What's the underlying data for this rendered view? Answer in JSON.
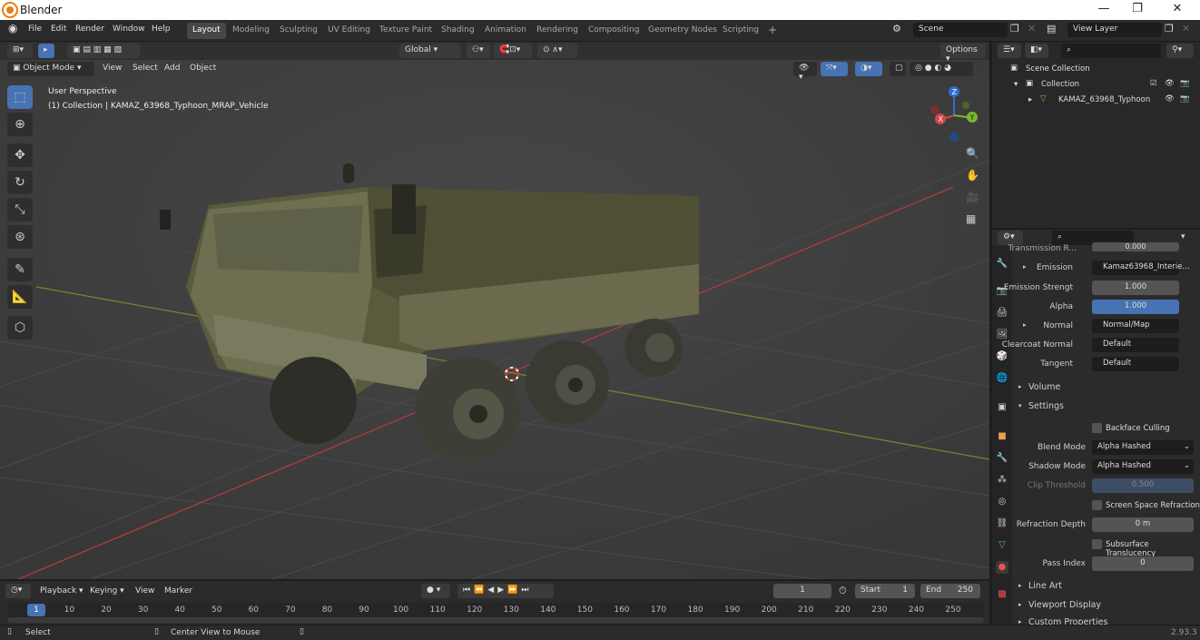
{
  "window": {
    "title": "Blender",
    "minimize": "—",
    "maximize": "❐",
    "close": "✕"
  },
  "menus": [
    "File",
    "Edit",
    "Render",
    "Window",
    "Help"
  ],
  "workspaces": [
    "Layout",
    "Modeling",
    "Sculpting",
    "UV Editing",
    "Texture Paint",
    "Shading",
    "Animation",
    "Rendering",
    "Compositing",
    "Geometry Nodes",
    "Scripting"
  ],
  "active_workspace": "Layout",
  "scene": {
    "name": "Scene",
    "view_layer": "View Layer"
  },
  "viewport_header": {
    "orientation": "Global",
    "options": "Options",
    "mode": "Object Mode",
    "menus": [
      "View",
      "Select",
      "Add",
      "Object"
    ]
  },
  "viewport": {
    "perspective": "User Perspective",
    "collection_info": "(1) Collection | KAMAZ_63968_Typhoon_MRAP_Vehicle"
  },
  "gizmo": {
    "x": "X",
    "y": "Y",
    "z": "Z"
  },
  "outliner": {
    "root": "Scene Collection",
    "collection": "Collection",
    "object": "KAMAZ_63968_Typhoon"
  },
  "properties": {
    "cut_label": "Transmission R...",
    "cut_value": "0.000",
    "rows": [
      {
        "label": "Emission",
        "value": "Kamaz63968_Interie...",
        "kind": "dark",
        "expand": true
      },
      {
        "label": "Emission Strengt",
        "value": "1.000",
        "kind": "normal"
      },
      {
        "label": "Alpha",
        "value": "1.000",
        "kind": "blue"
      },
      {
        "label": "Normal",
        "value": "Normal/Map",
        "kind": "dark",
        "expand": true
      },
      {
        "label": "Clearcoat Normal",
        "value": "Default",
        "kind": "dark"
      },
      {
        "label": "Tangent",
        "value": "Default",
        "kind": "dark"
      }
    ],
    "volume": "Volume",
    "settings": "Settings",
    "backface_culling": "Backface Culling",
    "blend_mode_label": "Blend Mode",
    "blend_mode": "Alpha Hashed",
    "shadow_mode_label": "Shadow Mode",
    "shadow_mode": "Alpha Hashed",
    "clip_threshold_label": "Clip Threshold",
    "clip_threshold": "0.500",
    "ssr": "Screen Space Refraction",
    "refraction_depth_label": "Refraction Depth",
    "refraction_depth": "0 m",
    "subsurface": "Subsurface Translucency",
    "pass_index_label": "Pass Index",
    "pass_index": "0",
    "line_art": "Line Art",
    "viewport_display": "Viewport Display",
    "custom_props": "Custom Properties"
  },
  "timeline": {
    "menus": [
      "Playback",
      "Keying",
      "View",
      "Marker"
    ],
    "current_frame": "1",
    "start_label": "Start",
    "start": "1",
    "end_label": "End",
    "end": "250",
    "ticks": [
      "1",
      "10",
      "20",
      "30",
      "40",
      "50",
      "60",
      "70",
      "80",
      "90",
      "100",
      "110",
      "120",
      "130",
      "140",
      "150",
      "160",
      "170",
      "180",
      "190",
      "200",
      "210",
      "220",
      "230",
      "240",
      "250"
    ]
  },
  "status": {
    "select": "Select",
    "center": "Center View to Mouse",
    "version": "2.93.3"
  }
}
